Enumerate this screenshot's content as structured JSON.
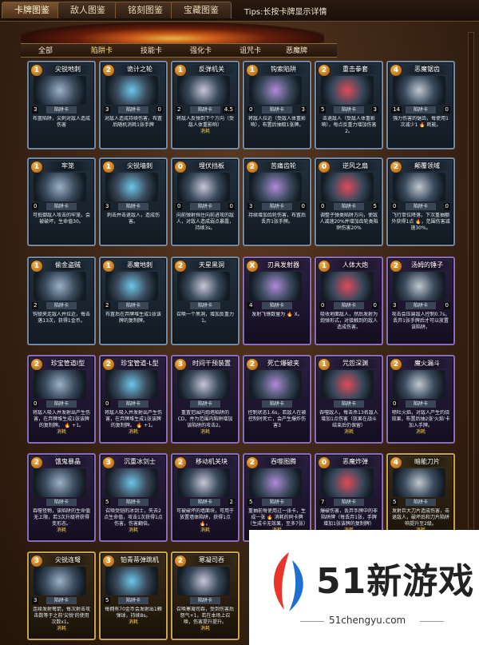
{
  "top_tabs": [
    "卡牌图鉴",
    "敌人图鉴",
    "铭刻图鉴",
    "宝藏图鉴"
  ],
  "tips": "Tips:长按卡牌显示详情",
  "categories": [
    "全部",
    "陷阱卡",
    "技能卡",
    "强化卡",
    "诅咒卡",
    "恶魔牌"
  ],
  "active_category": "陷阱卡",
  "cards": [
    {
      "name": "尖锐地刺",
      "cost": "1",
      "l": "3",
      "tag": "陷阱卡",
      "r": "",
      "desc": "布置陷阱，尖刺对敌人造成伤害"
    },
    {
      "name": "诡计之轮",
      "cost": "2",
      "l": "3",
      "tag": "陷阱卡",
      "r": "0",
      "desc": "对敌人造成持续伤害，布置后随机消耗1张手牌"
    },
    {
      "name": "反弹机关",
      "cost": "1",
      "l": "2",
      "tag": "陷阱卡",
      "r": "4.5",
      "desc": "将敌人反弹到下个方向（受敌人体重影响）",
      "consume": "消耗"
    },
    {
      "name": "钩索陷阱",
      "cost": "1",
      "l": "0",
      "tag": "陷阱卡",
      "r": "3",
      "desc": "将敌人拉近（受敌人体重影响），布置后抽取1张牌。"
    },
    {
      "name": "重击拳套",
      "cost": "2",
      "l": "5",
      "tag": "陷阱卡",
      "r": "3",
      "desc": "击退敌人（受敌人体重影响），每点反重力增加伤害2。"
    },
    {
      "name": "恶魔锯齿",
      "cost": "4",
      "l": "14",
      "tag": "陷阱卡",
      "r": "0",
      "desc": "强力伤害的锯齿，每使用1次减少1 🔥 耗能。"
    },
    {
      "name": "牢笼",
      "cost": "1",
      "l": "0",
      "tag": "陷阱卡",
      "r": "",
      "desc": "可抵御敌人攻击的牢笼，会被破坏，生命值30。"
    },
    {
      "name": "尖锐墙刺",
      "cost": "1",
      "l": "3",
      "tag": "陷阱卡",
      "r": "",
      "desc": "刺击并击退敌人，造成伤害。"
    },
    {
      "name": "埋伏挡板",
      "cost": "0",
      "l": "0",
      "tag": "陷阱卡",
      "r": "0",
      "desc": "向前弹射挡住向前进攻的敌人，对敌人造成弱点暴露，持续3s。"
    },
    {
      "name": "苦痛齿轮",
      "cost": "2",
      "l": "3",
      "tag": "陷阱卡",
      "r": "0",
      "desc": "持续增加齿轮伤害，布置后丢弃1张手牌。"
    },
    {
      "name": "逆风之扇",
      "cost": "0",
      "l": "0",
      "tag": "陷阱卡",
      "r": "5",
      "desc": "调整子弹类陷阱方向，使敌人减速20%并增加齿轮类陷阱伤害20%"
    },
    {
      "name": "颠覆领域",
      "cost": "2",
      "l": "0",
      "tag": "陷阱卡",
      "r": "0",
      "desc": "飞行单位降落，下次重抽额外获得1点 🔥，范围伤害减速30%。"
    },
    {
      "name": "偷金盗贼",
      "cost": "1",
      "l": "2",
      "tag": "陷阱卡",
      "r": "",
      "desc": "钩锁夹走敌人并拉近，每击落13次，获得1金币。"
    },
    {
      "name": "恶魔地刺",
      "cost": "1",
      "l": "2",
      "tag": "陷阱卡",
      "r": "",
      "desc": "布置后在弃牌堆生成1张该牌的复制牌。"
    },
    {
      "name": "天星黑洞",
      "cost": "2",
      "l": "",
      "tag": "陷阱卡",
      "r": "",
      "desc": "召唤一个黑洞，增加反重力1。"
    },
    {
      "name": "刃具发射器",
      "cost": "X",
      "l": "4",
      "tag": "陷阱卡",
      "r": "",
      "desc": "发射飞镖数量为 🔥 X。"
    },
    {
      "name": "人体大炮",
      "cost": "1",
      "l": "0",
      "tag": "陷阱卡",
      "r": "0",
      "desc": "吸收地面敌人，然后发射为炮弹形式，对接触到的敌人造成伤害。"
    },
    {
      "name": "汤姆的锤子",
      "cost": "2",
      "l": "3",
      "tag": "陷阱卡",
      "r": "0",
      "desc": "攻击会压扁敌人控制0.7s，丢弃1张手牌后才可以放置该陷阱。"
    },
    {
      "name": "珍宝管道I型",
      "cost": "2",
      "l": "0",
      "tag": "陷阱卡",
      "r": "",
      "desc": "将敌人吸入并发射出产生伤害，在弃牌堆生成1张该牌的复制牌。 🔥 +1。",
      "consume": "消耗"
    },
    {
      "name": "珍宝管道-L型",
      "cost": "2",
      "l": "0",
      "tag": "陷阱卡",
      "r": "",
      "desc": "将敌人吸入并发射出产生伤害，在弃牌堆生成1张该牌的复制牌。 🔥 +1。",
      "consume": "消耗"
    },
    {
      "name": "时间干预装置",
      "cost": "3",
      "l": "",
      "tag": "陷阱卡",
      "r": "",
      "desc": "重置范围内炮塔陷阱的CD，并为范围内陷阱增加该陷阱的攻击2。",
      "consume": "消耗"
    },
    {
      "name": "死亡爆破夹",
      "cost": "2",
      "l": "",
      "tag": "陷阱卡",
      "r": "",
      "desc": "控制状态1.6s，若敌人在被控制时死亡，会产生爆炸伤害3"
    },
    {
      "name": "咒怨深渊",
      "cost": "1",
      "l": "",
      "tag": "陷阱卡",
      "r": "",
      "desc": "吞噬敌人，每击杀13名敌人增加1点伤害（效果在战斗结束后仍保留）",
      "consume": "消耗"
    },
    {
      "name": "魔火漏斗",
      "cost": "2",
      "l": "0",
      "tag": "陷阱卡",
      "r": "",
      "desc": "喷吐火焰，对敌人产生灼烧效果，布置后抽2张'火焰'卡加入手牌。",
      "consume": "消耗"
    },
    {
      "name": "饿鬼暴晶",
      "cost": "2",
      "l": "",
      "tag": "陷阱卡",
      "r": "",
      "desc": "吞噬怪物，该陷阱的生命值无上限，若3次升级将获得变形态。",
      "consume": "消耗"
    },
    {
      "name": "沉重冰剑士",
      "cost": "3",
      "l": "5",
      "tag": "陷阱卡",
      "r": "",
      "desc": "召唤受铠的冰剑士，失去2点生命值，攻击1次获得1点伤害，伤害翻倍。",
      "consume": "消耗"
    },
    {
      "name": "移动机关块",
      "cost": "2",
      "l": "",
      "tag": "陷阱卡",
      "r": "2",
      "desc": "可被破坏的墙面块，可用于放置墙体陷阱，获得1点 🔥。",
      "consume": "消耗"
    },
    {
      "name": "吞噬图腾",
      "cost": "2",
      "l": "5",
      "tag": "陷阱卡",
      "r": "",
      "desc": "重抽前每使用过一张卡，生成一张 🔥 消耗的同卡牌（生成卡无效果，至多7张）",
      "consume": "消耗"
    },
    {
      "name": "恶魔炸弹",
      "cost": "0",
      "l": "7",
      "tag": "陷阱卡",
      "r": "",
      "desc": "爆破伤害，丢弃手牌中的非陷阱牌（每丢弃1张，手牌增加1张该牌的复制牌）",
      "consume": "消耗"
    },
    {
      "name": "暗能刀片",
      "cost": "4",
      "l": "5",
      "tag": "陷阱卡",
      "r": "",
      "desc": "发射巨大刀片造成伤害，击退敌人，破坏后和刀片陷阱响提升至2级。",
      "consume": "消耗"
    },
    {
      "name": "尖锐连弩",
      "cost": "3",
      "l": "3",
      "tag": "陷阱卡",
      "r": "",
      "desc": "连续发射弩箭，每次射击攻击数等于之前'尖锐'的使用次数x1。",
      "consume": "消耗"
    },
    {
      "name": "铂青蒂弹跳机",
      "cost": "3",
      "l": "5",
      "tag": "陷阱卡",
      "r": "",
      "desc": "每拥有70金币会发射出1颗弹球，持续8s。",
      "consume": "消耗"
    },
    {
      "name": "寒凝司吞",
      "cost": "2",
      "l": "",
      "tag": "陷阱卡",
      "r": "",
      "desc": "召唤寒凝司吞，受到伤害后怒气+1，若在本场上召唤，伤害提升提升。",
      "consume": "消耗"
    }
  ],
  "watermark": {
    "brand": "51新游戏",
    "site": "51chengyu.com"
  }
}
